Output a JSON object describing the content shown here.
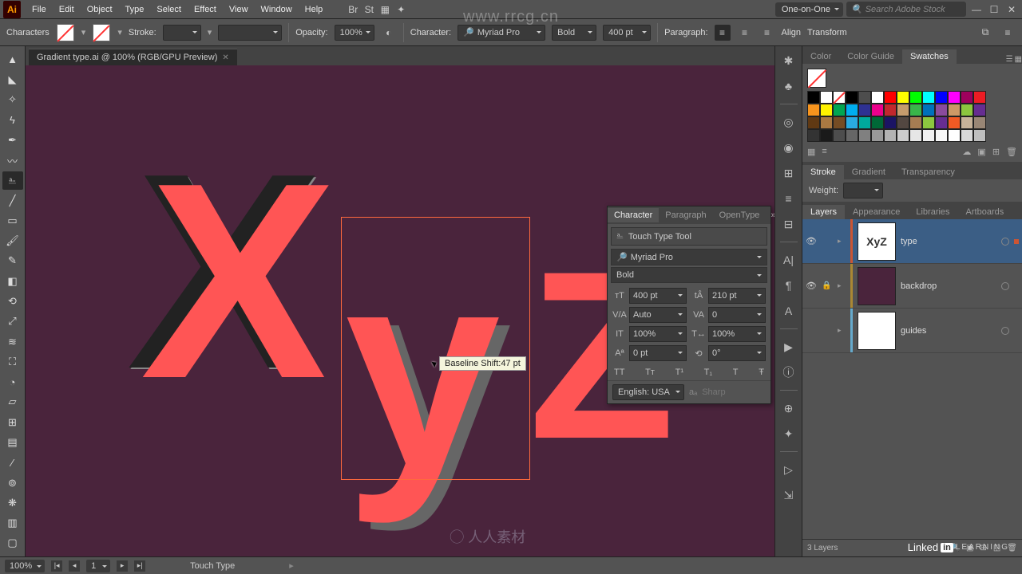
{
  "app": {
    "short": "Ai"
  },
  "menubar": {
    "items": [
      "File",
      "Edit",
      "Object",
      "Type",
      "Select",
      "Effect",
      "View",
      "Window",
      "Help"
    ],
    "workspace": "One-on-One",
    "search_placeholder": "Search Adobe Stock"
  },
  "controlbar": {
    "left_label": "Characters",
    "stroke_label": "Stroke:",
    "opacity_label": "Opacity:",
    "opacity_value": "100%",
    "character_label": "Character:",
    "font_family": "Myriad Pro",
    "font_style": "Bold",
    "font_size": "400 pt",
    "paragraph_label": "Paragraph:",
    "align_label": "Align",
    "transform_label": "Transform"
  },
  "doc": {
    "tab_title": "Gradient type.ai @ 100% (RGB/GPU Preview)"
  },
  "tooltip": "Baseline Shift:47 pt",
  "char_panel": {
    "tabs": [
      "Character",
      "Paragraph",
      "OpenType"
    ],
    "touch_label": "Touch Type Tool",
    "font_family": "Myriad Pro",
    "font_style": "Bold",
    "size": "400 pt",
    "leading": "210 pt",
    "kerning": "Auto",
    "tracking": "0",
    "vscale": "100%",
    "hscale": "100%",
    "baseline": "0 pt",
    "rotation": "0°",
    "caps": [
      "TT",
      "Tт",
      "T¹",
      "T₁",
      "T",
      "Ŧ"
    ],
    "language": "English: USA",
    "aa_label": "aₐ",
    "aa_value": "Sharp"
  },
  "swatches": {
    "tabs": [
      "Color",
      "Color Guide",
      "Swatches"
    ],
    "colors_row1": [
      "#000000",
      "#ffffff",
      "transparent",
      "#000000",
      "#4d4d4d",
      "#ffffff",
      "#ff0000",
      "#ffff00",
      "#00ff00",
      "#00ffff",
      "#0000ff",
      "#ff00ff",
      "#9e005d",
      "#ed1c24"
    ],
    "colors_row2": [
      "#f7941d",
      "#fff200",
      "#00a651",
      "#00aeef",
      "#2e3192",
      "#ec008c",
      "#c1272d",
      "#c69c6d",
      "#39b54a",
      "#0071bc",
      "#8a4b9d",
      "#cc9966",
      "#8cc63f",
      "#662d91"
    ],
    "colors_row3": [
      "#603913",
      "#aa7942",
      "#754c24",
      "#29abe2",
      "#00a99d",
      "#006837",
      "#1b1464",
      "#534741",
      "#a67c52",
      "#8cc63f",
      "#662d91",
      "#f15a24",
      "#c7b299",
      "#998675"
    ],
    "colors_row4": [
      "#333333",
      "#1a1a1a",
      "#4d4d4d",
      "#666666",
      "#808080",
      "#999999",
      "#b3b3b3",
      "#cccccc",
      "#e6e6e6",
      "#f2f2f2",
      "#f7f7f7",
      "#ffffff",
      "#d9d9d9",
      "#bfbfbf"
    ]
  },
  "stroke_panel": {
    "tabs": [
      "Stroke",
      "Gradient",
      "Transparency"
    ],
    "weight_label": "Weight:"
  },
  "layers_panel": {
    "tabs": [
      "Layers",
      "Appearance",
      "Libraries",
      "Artboards"
    ],
    "rows": [
      {
        "name": "type",
        "thumb": "XyZ",
        "color": "#cc5533",
        "eye": true,
        "lock": false,
        "selected": true,
        "targeted": true
      },
      {
        "name": "backdrop",
        "thumb_bg": "#4a243c",
        "color": "#aa8833",
        "eye": true,
        "lock": true,
        "selected": false
      },
      {
        "name": "guides",
        "thumb_bg": "#ffffff",
        "color": "#66aacc",
        "eye": false,
        "lock": false,
        "selected": false
      }
    ],
    "footer": "3 Layers"
  },
  "statusbar": {
    "zoom": "100%",
    "nav_value": "1",
    "tool": "Touch Type"
  },
  "brand": {
    "linked": "Linked",
    "in": "in",
    "learning": "LEARNING"
  },
  "watermark": {
    "url": "www.rrcg.cn",
    "mid": "◯ 人人素材"
  }
}
